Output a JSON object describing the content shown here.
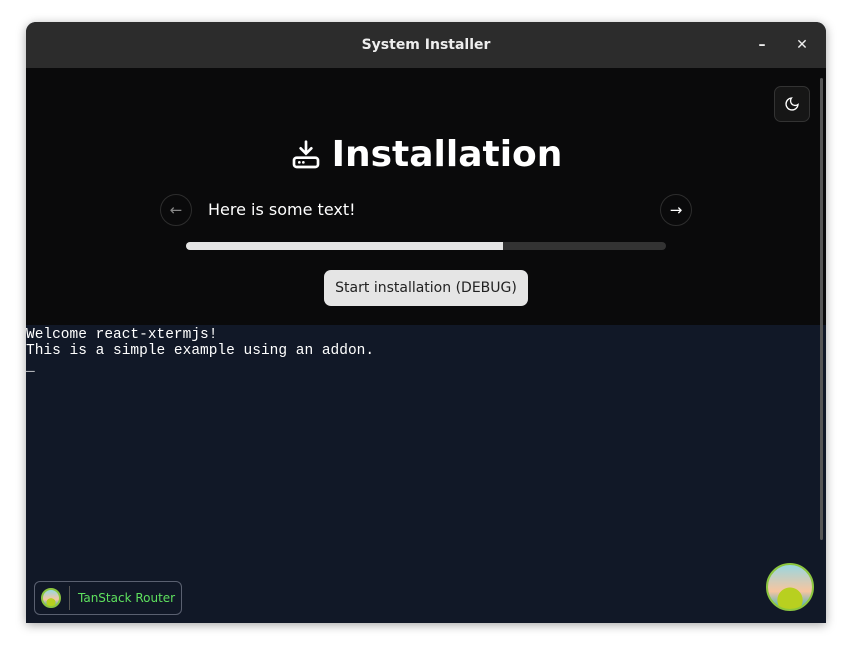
{
  "window": {
    "title": "System Installer",
    "minimize": "–",
    "close": "✕"
  },
  "header": {
    "title": "Installation",
    "theme_icon": "moon-icon",
    "install_icon": "download-icon"
  },
  "carousel": {
    "text": "Here is some text!",
    "prev": "←",
    "next": "→"
  },
  "progress": {
    "value": 0.66
  },
  "actions": {
    "start_label": "Start installation (DEBUG)"
  },
  "terminal": {
    "lines": [
      "Welcome react-xtermjs!",
      "This is a simple example using an addon.",
      "_"
    ]
  },
  "devtools": {
    "label": "TanStack Router"
  }
}
